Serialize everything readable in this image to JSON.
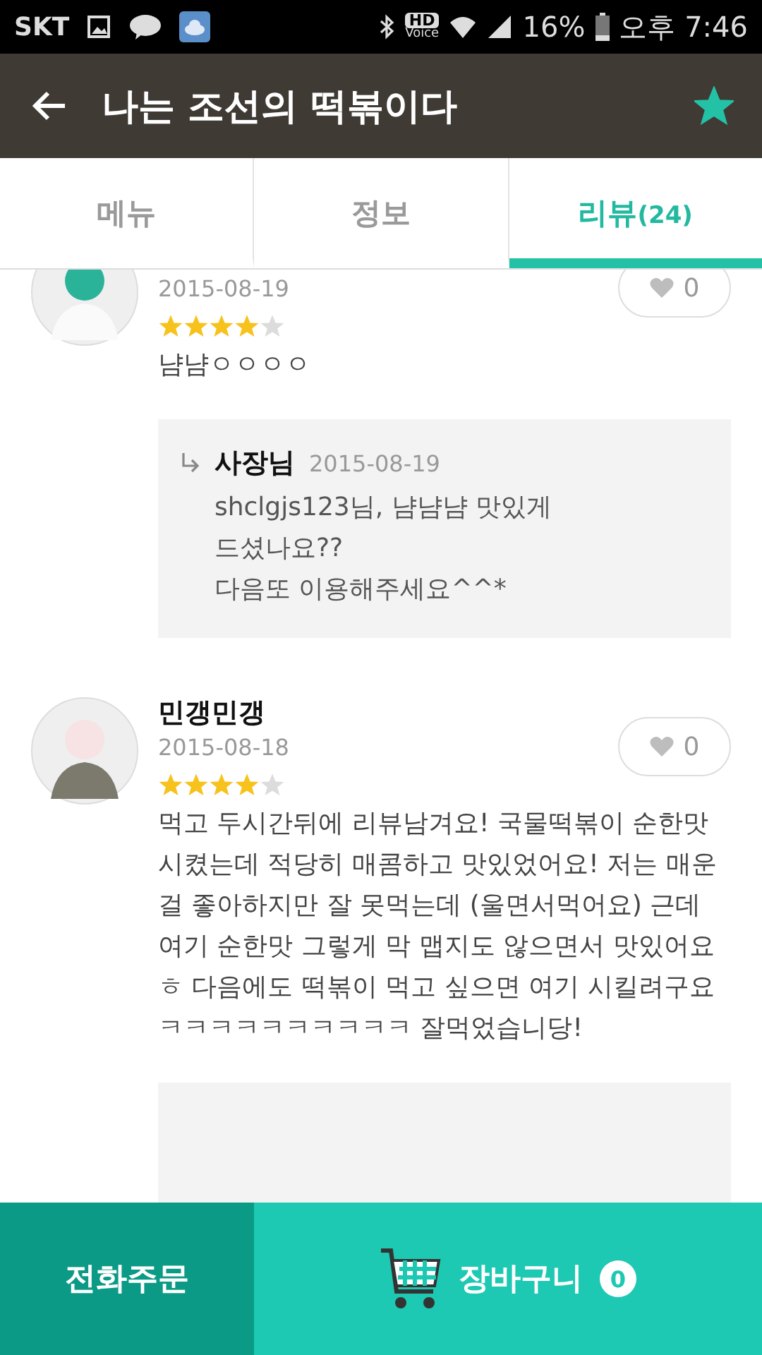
{
  "status_bar": {
    "carrier": "SKT",
    "hd": "HD",
    "voice": "Voice",
    "battery": "16%",
    "time": "오후 7:46"
  },
  "app_bar": {
    "title": "나는 조선의 떡볶이다",
    "favorite": true
  },
  "tabs": [
    {
      "label": "메뉴",
      "selected": false
    },
    {
      "label": "정보",
      "selected": false
    },
    {
      "label": "리뷰",
      "count": "(24)",
      "selected": true
    }
  ],
  "reviews": [
    {
      "date": "2015-08-19",
      "likes": "0",
      "stars": 4,
      "text": "냠냠ㅇㅇㅇㅇ",
      "reply": {
        "author": "사장님",
        "date": "2015-08-19",
        "lines": [
          "shclgjs123님, 냠냠냠 맛있게",
          "드셨나요??",
          "다음또 이용해주세요^^*"
        ]
      }
    },
    {
      "name": "민갱민갱",
      "date": "2015-08-18",
      "likes": "0",
      "stars": 4,
      "text": "먹고 두시간뒤에 리뷰남겨요! 국물떡볶이 순한맛 시켰는데 적당히 매콤하고 맛있었어요! 저는 매운 걸 좋아하지만 잘 못먹는데 (울면서먹어요) 근데 여기 순한맛 그렇게 막 맵지도 않으면서 맛있어요ㅎ 다음에도 떡볶이 먹고 싶으면 여기 시킬려구요 ㅋㅋㅋㅋㅋㅋㅋㅋㅋㅋ 잘먹었습니당!",
      "reply": {
        "kind": "cut"
      }
    }
  ],
  "bottom_bar": {
    "phone_order": "전화주문",
    "cart": "장바구니",
    "cart_count": "0"
  }
}
